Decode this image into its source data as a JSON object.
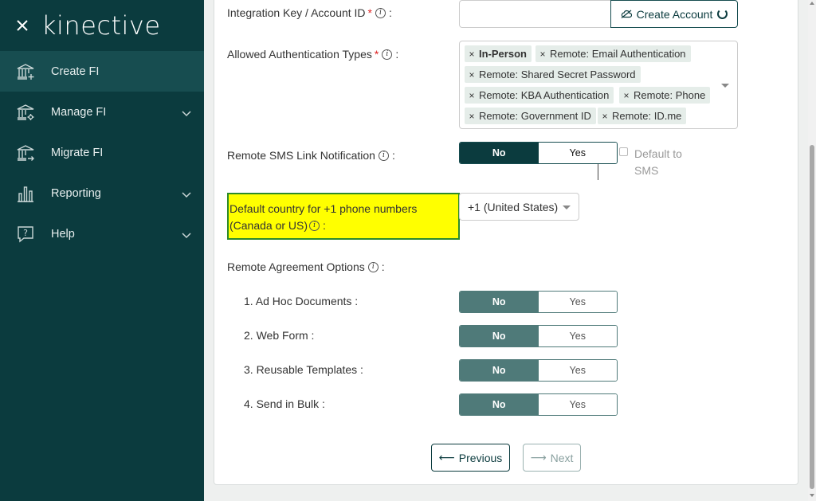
{
  "sidebar": {
    "logo_text": "kinective",
    "items": [
      {
        "label": "Create FI",
        "icon": "bank-add-icon",
        "active": true,
        "has_chevron": false
      },
      {
        "label": "Manage FI",
        "icon": "bank-gear-icon",
        "has_chevron": true
      },
      {
        "label": "Migrate FI",
        "icon": "bank-arrow-icon",
        "has_chevron": false
      },
      {
        "label": "Reporting",
        "icon": "bar-chart-icon",
        "has_chevron": true
      },
      {
        "label": "Help",
        "icon": "help-bubble-icon",
        "has_chevron": true
      }
    ]
  },
  "form": {
    "integration_key": {
      "label": "Integration Key / Account ID",
      "required": "*",
      "colon": ":",
      "value": "",
      "button_label": "Create Account"
    },
    "auth_types": {
      "label": "Allowed Authentication Types",
      "required": "*",
      "colon": ":",
      "tags": [
        "In-Person",
        "Remote: Email Authentication",
        "Remote: Shared Secret Password",
        "Remote: KBA Authentication",
        "Remote: Phone",
        "Remote: Government ID",
        "Remote: ID.me"
      ]
    },
    "sms_link": {
      "label": "Remote SMS Link Notification",
      "colon": ":",
      "no_label": "No",
      "yes_label": "Yes",
      "selected": "No",
      "default_sms_label": "Default to SMS",
      "default_sms_checked": false
    },
    "default_country": {
      "label_line1": "Default country for +1 phone numbers",
      "label_line2": "(Canada or US)",
      "colon": ":",
      "selected": "+1 (United States)"
    },
    "remote_agreement": {
      "label": "Remote Agreement Options",
      "colon": ":",
      "options": [
        {
          "label": "1. Ad Hoc Documents :",
          "no": "No",
          "yes": "Yes",
          "selected": "No"
        },
        {
          "label": "2. Web Form :",
          "no": "No",
          "yes": "Yes",
          "selected": "No"
        },
        {
          "label": "3. Reusable Templates :",
          "no": "No",
          "yes": "Yes",
          "selected": "No"
        },
        {
          "label": "4. Send in Bulk :",
          "no": "No",
          "yes": "Yes",
          "selected": "No"
        }
      ]
    }
  },
  "nav_buttons": {
    "previous": "Previous",
    "next": "Next",
    "previous_arrow": "⟵",
    "next_arrow": "⟶"
  },
  "colors": {
    "sidebar_bg": "#0b3b3e",
    "highlight": "#ffff00",
    "tag_bg": "#e5ede9"
  }
}
